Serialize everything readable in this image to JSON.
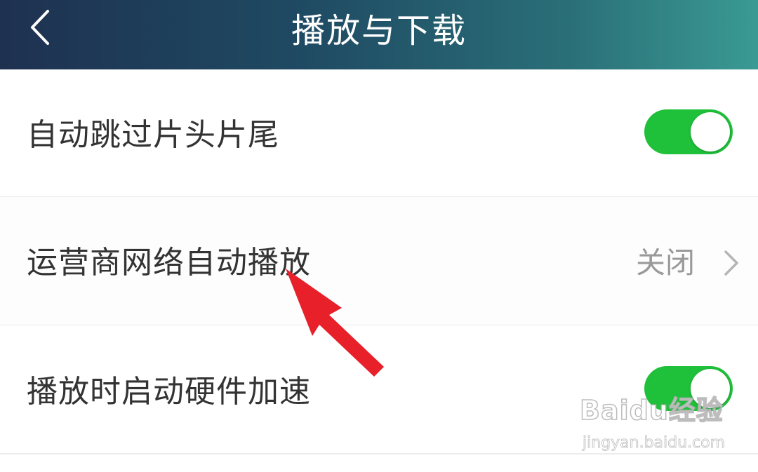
{
  "header": {
    "title": "播放与下载",
    "back_icon": "chevron-left-icon"
  },
  "settings": [
    {
      "label": "自动跳过片头片尾",
      "control": "toggle",
      "on": true
    },
    {
      "label": "运营商网络自动播放",
      "control": "disclosure",
      "value": "关闭"
    },
    {
      "label": "播放时启动硬件加速",
      "control": "toggle",
      "on": true
    }
  ],
  "colors": {
    "toggle_on": "#1fc03a",
    "header_gradient_start": "#1e3150",
    "header_gradient_end": "#3a9a93",
    "annotation_arrow": "#e8202a"
  },
  "watermark": {
    "logo_text": "Baidu经验",
    "url": "jingyan.baidu.com"
  }
}
